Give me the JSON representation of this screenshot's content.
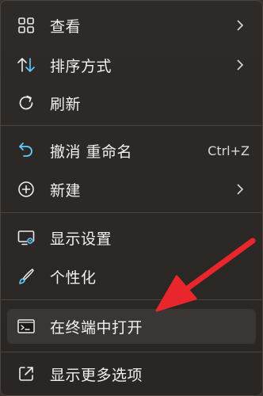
{
  "menu": {
    "items": [
      {
        "label": "查看",
        "icon": "grid-icon",
        "has_submenu": true
      },
      {
        "label": "排序方式",
        "icon": "sort-icon",
        "has_submenu": true
      },
      {
        "label": "刷新",
        "icon": "refresh-icon",
        "has_submenu": false
      },
      {
        "label": "撤消 重命名",
        "icon": "undo-icon",
        "shortcut": "Ctrl+Z"
      },
      {
        "label": "新建",
        "icon": "add-circle-icon",
        "has_submenu": true
      },
      {
        "label": "显示设置",
        "icon": "display-settings-icon",
        "has_submenu": false
      },
      {
        "label": "个性化",
        "icon": "brush-icon",
        "has_submenu": false
      },
      {
        "label": "在终端中打开",
        "icon": "terminal-icon",
        "has_submenu": false
      },
      {
        "label": "显示更多选项",
        "icon": "share-icon",
        "has_submenu": false
      }
    ]
  },
  "colors": {
    "accent": "#60cdff",
    "arrow": "#e8262b",
    "text": "#f1f1f1"
  }
}
